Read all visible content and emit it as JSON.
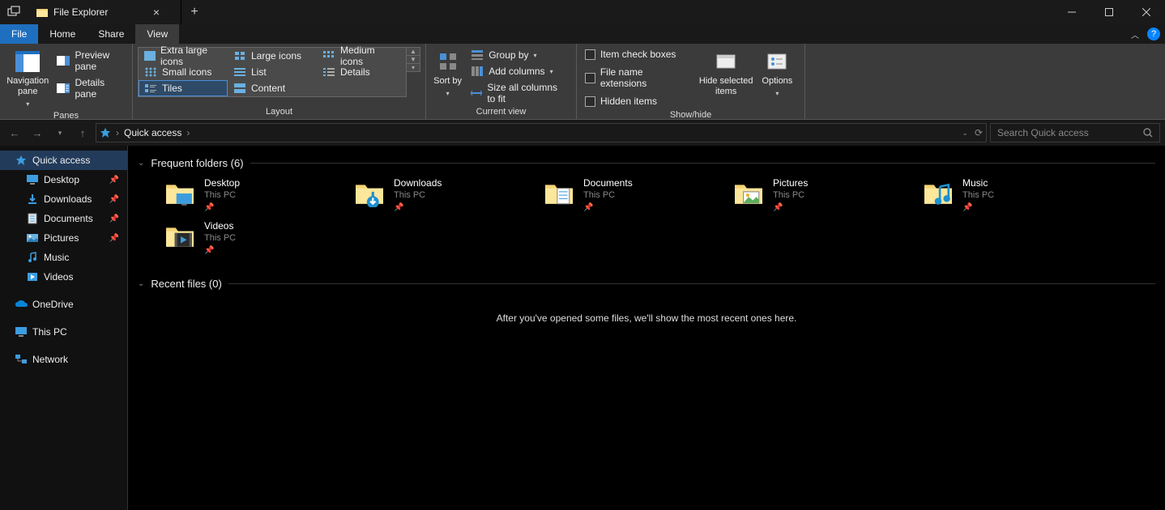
{
  "titlebar": {
    "title": "File Explorer"
  },
  "menus": {
    "file": "File",
    "home": "Home",
    "share": "Share",
    "view": "View",
    "active": "View"
  },
  "ribbon": {
    "panes": {
      "nav": "Navigation pane",
      "preview": "Preview pane",
      "details": "Details pane",
      "group": "Panes"
    },
    "layout": {
      "items": [
        "Extra large icons",
        "Large icons",
        "Medium icons",
        "Small icons",
        "List",
        "Details",
        "Tiles",
        "Content"
      ],
      "selected": "Tiles",
      "group": "Layout"
    },
    "currentview": {
      "sort": "Sort by",
      "groupby": "Group by",
      "addcols": "Add columns",
      "sizecols": "Size all columns to fit",
      "group": "Current view"
    },
    "showhide": {
      "itemcheck": "Item check boxes",
      "ext": "File name extensions",
      "hidden": "Hidden items",
      "hideselected": "Hide selected items",
      "options": "Options",
      "group": "Show/hide"
    }
  },
  "address": {
    "location": "Quick access"
  },
  "search": {
    "placeholder": "Search Quick access"
  },
  "tree": {
    "quick": "Quick access",
    "items": [
      {
        "label": "Desktop",
        "pin": true
      },
      {
        "label": "Downloads",
        "pin": true
      },
      {
        "label": "Documents",
        "pin": true
      },
      {
        "label": "Pictures",
        "pin": true
      },
      {
        "label": "Music",
        "pin": false
      },
      {
        "label": "Videos",
        "pin": false
      }
    ],
    "onedrive": "OneDrive",
    "thispc": "This PC",
    "network": "Network"
  },
  "content": {
    "frequent_header": "Frequent folders (6)",
    "folders": [
      {
        "name": "Desktop",
        "sub": "This PC",
        "icon": "desktop"
      },
      {
        "name": "Downloads",
        "sub": "This PC",
        "icon": "downloads"
      },
      {
        "name": "Documents",
        "sub": "This PC",
        "icon": "documents"
      },
      {
        "name": "Pictures",
        "sub": "This PC",
        "icon": "pictures"
      },
      {
        "name": "Music",
        "sub": "This PC",
        "icon": "music"
      },
      {
        "name": "Videos",
        "sub": "This PC",
        "icon": "videos"
      }
    ],
    "recent_header": "Recent files (0)",
    "recent_empty": "After you've opened some files, we'll show the most recent ones here."
  }
}
